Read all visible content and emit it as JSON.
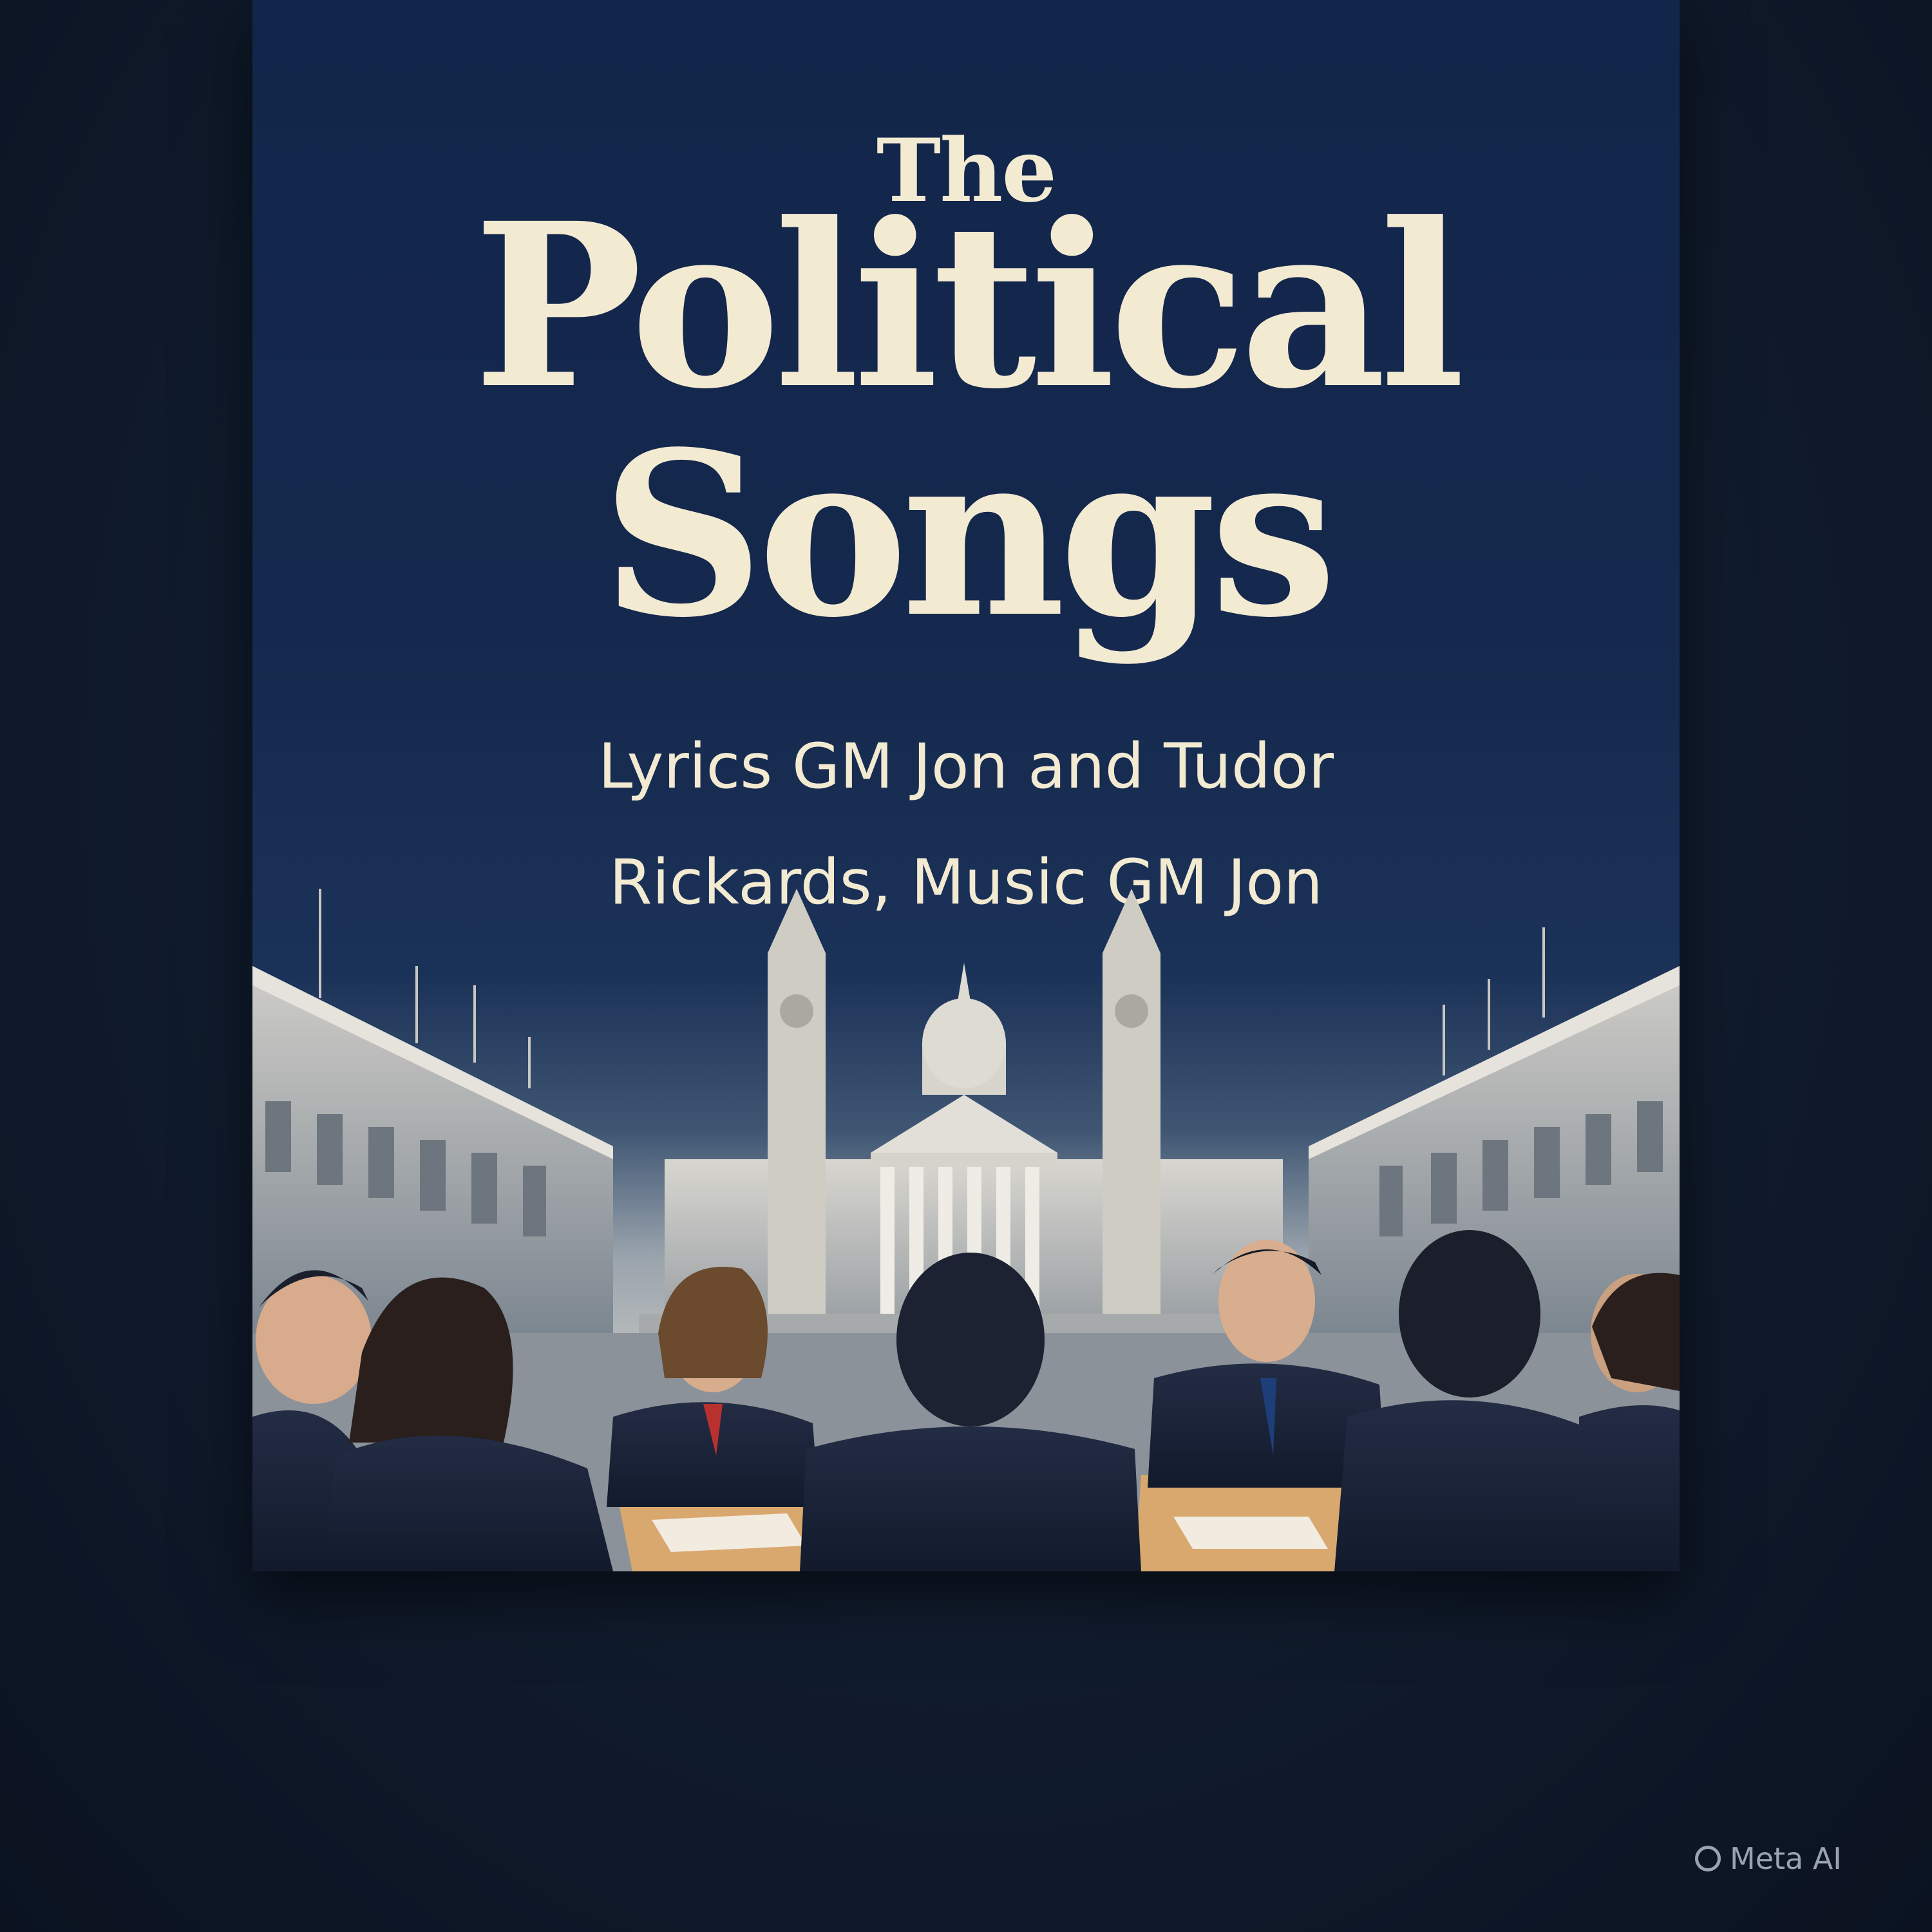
{
  "cover": {
    "title_line1": "The",
    "title_line2": "Political",
    "title_line3": "Songs",
    "credits_line1": "Lyrics GM Jon and Tudor",
    "credits_line2": "Rickards, Music GM Jon"
  },
  "watermark": {
    "label": "Meta AI"
  },
  "colors": {
    "background": "#101b2c",
    "cover_navy": "#15284d",
    "title_cream": "#f3ead2",
    "suit_dark": "#1a2236",
    "table_wood": "#d9a86f"
  }
}
